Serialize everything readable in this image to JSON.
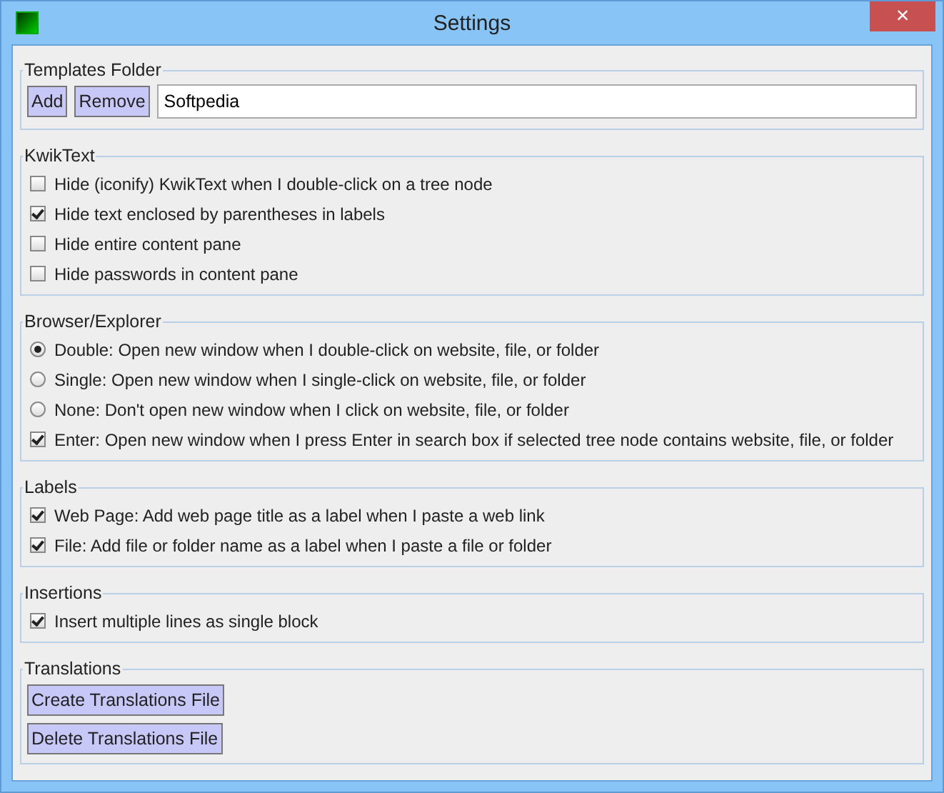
{
  "window": {
    "title": "Settings",
    "close": "×"
  },
  "sections": [
    {
      "kind": "folder",
      "title": "Templates Folder",
      "buttons": [
        "Add",
        "Remove"
      ],
      "field": {
        "value": "Softpedia"
      }
    },
    {
      "kind": "options",
      "title": "KwikText",
      "items": [
        {
          "kind": "checkbox",
          "label": "Hide (iconify) KwikText when I double-click on a tree node",
          "checked": false
        },
        {
          "kind": "checkbox",
          "label": "Hide text enclosed by parentheses in labels",
          "checked": true
        },
        {
          "kind": "checkbox",
          "label": "Hide entire content pane",
          "checked": false
        },
        {
          "kind": "checkbox",
          "label": "Hide passwords in content pane",
          "checked": false
        }
      ]
    },
    {
      "kind": "options",
      "title": "Browser/Explorer",
      "items": [
        {
          "kind": "radio",
          "label": "Double: Open new window when I double-click on website, file, or folder",
          "checked": true
        },
        {
          "kind": "radio",
          "label": "Single: Open new window when I single-click on website, file, or folder",
          "checked": false
        },
        {
          "kind": "radio",
          "label": "None: Don't open new window when I click on website, file, or folder",
          "checked": false
        },
        {
          "kind": "checkbox",
          "label": "Enter: Open new window when I press Enter in search box if selected tree node contains website, file, or folder",
          "checked": true
        }
      ]
    },
    {
      "kind": "options",
      "title": "Labels",
      "items": [
        {
          "kind": "checkbox",
          "label": "Web Page: Add web page title as a label when I paste a web link",
          "checked": true
        },
        {
          "kind": "checkbox",
          "label": "File: Add file or folder name as a label when I paste a file or folder",
          "checked": true
        }
      ]
    },
    {
      "kind": "options",
      "title": "Insertions",
      "items": [
        {
          "kind": "checkbox",
          "label": "Insert multiple lines as single block",
          "checked": true
        }
      ]
    },
    {
      "kind": "buttons",
      "title": "Translations",
      "buttons": [
        "Create Translations File",
        "Delete Translations File"
      ]
    }
  ]
}
